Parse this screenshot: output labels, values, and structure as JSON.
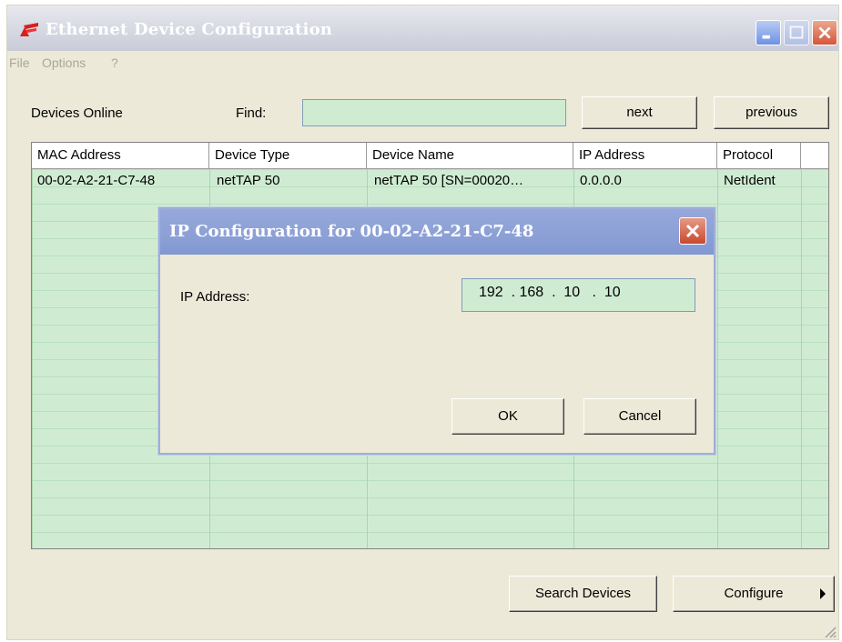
{
  "window": {
    "title": "Ethernet Device Configuration",
    "icon": "app-logo-icon",
    "controls": [
      "minimize-icon",
      "maximize-icon",
      "close-icon"
    ]
  },
  "menu": [
    "File",
    "Options",
    "?"
  ],
  "toolbar": {
    "devices_online_label": "Devices Online",
    "find_label": "Find:",
    "find_value": "",
    "next_label": "next",
    "previous_label": "previous"
  },
  "table": {
    "columns": [
      "MAC Address",
      "Device Type",
      "Device Name",
      "IP Address",
      "Protocol"
    ],
    "rows": [
      [
        "00-02-A2-21-C7-48",
        "netTAP 50",
        "netTAP 50 [SN=00020…",
        "0.0.0.0",
        "NetIdent"
      ]
    ]
  },
  "dialog": {
    "title": "IP Configuration for  00-02-A2-21-C7-48",
    "ip_label": "IP Address:",
    "ip_value": "192  . 168  .  10   .  10",
    "ok_label": "OK",
    "cancel_label": "Cancel"
  },
  "footer": {
    "search_label": "Search Devices",
    "configure_label": "Configure"
  },
  "colors": {
    "grid_bg": "#cfecd3",
    "window_bg": "#ece9d8",
    "dialog_title_bg": "#8ca0d6",
    "close_button": "#d5553a"
  }
}
